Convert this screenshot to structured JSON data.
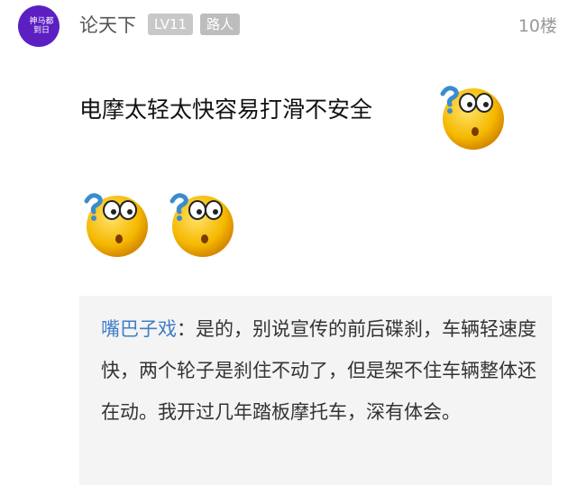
{
  "comment": {
    "avatar_text": "神马都到日",
    "username": "论天下",
    "level_badge": "LV11",
    "role_badge": "路人",
    "floor": "10楼",
    "text": "电摩太轻太快容易打滑不安全",
    "emojis": [
      "confused-face-icon",
      "confused-face-icon",
      "confused-face-icon"
    ]
  },
  "quote": {
    "author": "嘴巴子戏",
    "separator": "：",
    "text": "是的，别说宣传的前后碟刹，车辆轻速度快，两个轮子是刹住不动了，但是架不住车辆整体还在动。我开过几年踏板摩托车，深有体会。"
  },
  "colors": {
    "avatar_bg": "#5b1fc2",
    "quote_author": "#3f7ec7",
    "quote_bg": "#f4f4f4",
    "badge_bg": "#c8c8c8"
  }
}
